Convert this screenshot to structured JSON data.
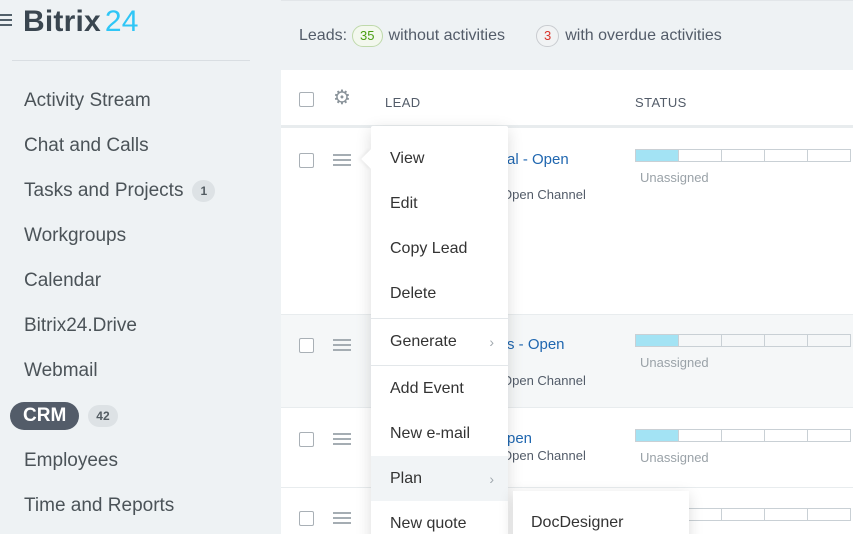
{
  "app": {
    "logo_name": "Bitrix",
    "logo_number": "24"
  },
  "sidebar": {
    "items": [
      {
        "label": "Activity Stream"
      },
      {
        "label": "Chat and Calls"
      },
      {
        "label": "Tasks and Projects",
        "count": "1"
      },
      {
        "label": "Workgroups"
      },
      {
        "label": "Calendar"
      },
      {
        "label": "Bitrix24.Drive"
      },
      {
        "label": "Webmail"
      },
      {
        "label": "CRM",
        "count": "42",
        "active": true
      },
      {
        "label": "Employees"
      },
      {
        "label": "Time and Reports"
      }
    ]
  },
  "summary": {
    "leads_label": "Leads:",
    "without_count": "35",
    "without_label": "without activities",
    "overdue_count": "3",
    "overdue_label": "with overdue activities"
  },
  "table": {
    "columns": {
      "lead": "LEAD",
      "status": "STATUS"
    },
    "rows": [
      {
        "title": "al - Open",
        "source": "Open Channel",
        "status": "Unassigned",
        "progress_segments_filled": 1,
        "progress_segments_total": 5
      },
      {
        "title": "s - Open",
        "source": "Open Channel",
        "status": "Unassigned",
        "progress_segments_filled": 1,
        "progress_segments_total": 5
      },
      {
        "title": "pen",
        "source": "Open Channel",
        "status": "Unassigned",
        "progress_segments_filled": 1,
        "progress_segments_total": 5
      },
      {
        "title": "",
        "source": "",
        "status": "",
        "progress_segments_filled": 0,
        "progress_segments_total": 5
      }
    ]
  },
  "context_menu": {
    "items": [
      {
        "label": "View"
      },
      {
        "label": "Edit"
      },
      {
        "label": "Copy Lead"
      },
      {
        "label": "Delete"
      },
      {
        "label": "Generate",
        "submenu_indicator": "›"
      },
      {
        "label": "Add Event"
      },
      {
        "label": "New e-mail"
      },
      {
        "label": "Plan",
        "submenu_indicator": "›"
      },
      {
        "label": "New quote"
      }
    ]
  },
  "submenu": {
    "items": [
      {
        "label": "DocDesigner"
      }
    ]
  },
  "colors": {
    "accent": "#2fc6f6",
    "link": "#2067b0",
    "active_nav": "#535c69",
    "status_fill": "#a3e3f4",
    "badge_green": "#4a9e12",
    "badge_red": "#d9342b"
  },
  "icons": {
    "menu": "hamburger-icon",
    "settings": "gear-icon",
    "row_menu": "row-menu-icon",
    "submenu": "chevron-right-icon"
  }
}
